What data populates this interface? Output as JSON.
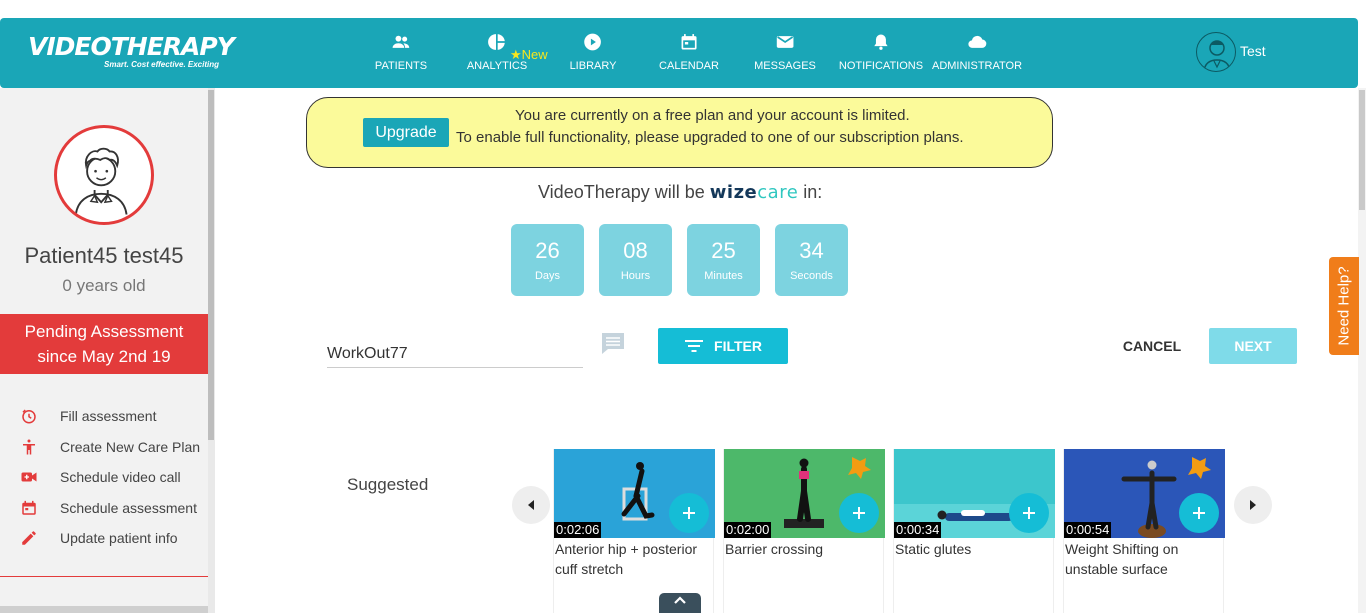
{
  "app": {
    "logo_text": "VIDEOTHERAPY",
    "logo_tagline": "Smart. Cost effective. Exciting"
  },
  "nav": {
    "items": [
      {
        "label": "PATIENTS",
        "icon": "people-icon"
      },
      {
        "label": "ANALYTICS",
        "icon": "pie-chart-icon"
      },
      {
        "label": "LIBRARY",
        "icon": "play-circle-icon"
      },
      {
        "label": "CALENDAR",
        "icon": "calendar-icon"
      },
      {
        "label": "MESSAGES",
        "icon": "envelope-icon"
      },
      {
        "label": "NOTIFICATIONS",
        "icon": "bell-icon"
      },
      {
        "label": "ADMINISTRATOR",
        "icon": "cloud-icon"
      }
    ],
    "new_badge": "New",
    "user_name": "Test"
  },
  "patient": {
    "name": "Patient45 test45",
    "age": "0 years old",
    "status_line1": "Pending Assessment",
    "status_line2": "since May 2nd 19"
  },
  "sidebar_menu": [
    {
      "label": "Fill assessment",
      "icon": "timer-icon"
    },
    {
      "label": "Create New Care Plan",
      "icon": "accessibility-icon"
    },
    {
      "label": "Schedule video call",
      "icon": "video-icon"
    },
    {
      "label": "Schedule assessment",
      "icon": "calendar-icon"
    },
    {
      "label": "Update patient info",
      "icon": "pencil-icon"
    }
  ],
  "banner": {
    "upgrade_label": "Upgrade",
    "line1": "You are currently on a free plan and your account is limited.",
    "line2": "To enable full functionality, please upgraded to one of our subscription plans."
  },
  "announcement": {
    "prefix": "VideoTherapy will be",
    "brand_part1": "wize",
    "brand_part2": "care",
    "suffix": "in:"
  },
  "countdown": [
    {
      "value": "26",
      "label": "Days"
    },
    {
      "value": "08",
      "label": "Hours"
    },
    {
      "value": "25",
      "label": "Minutes"
    },
    {
      "value": "34",
      "label": "Seconds"
    }
  ],
  "toolbar": {
    "workout_name": "WorkOut77",
    "filter_label": "FILTER",
    "cancel_label": "CANCEL",
    "next_label": "NEXT"
  },
  "help": {
    "label": "Need Help?"
  },
  "suggested": {
    "heading": "Suggested",
    "videos": [
      {
        "duration": "0:02:06",
        "title": "Anterior hip + posterior cuff stretch",
        "bg": "#2aa3d8"
      },
      {
        "duration": "0:02:00",
        "title": "Barrier crossing",
        "bg": "#4db86a"
      },
      {
        "duration": "0:00:34",
        "title": "Static glutes",
        "bg": "#3cc6cc"
      },
      {
        "duration": "0:00:54",
        "title": "Weight Shifting on unstable surface",
        "bg": "#2b56b8"
      }
    ]
  }
}
